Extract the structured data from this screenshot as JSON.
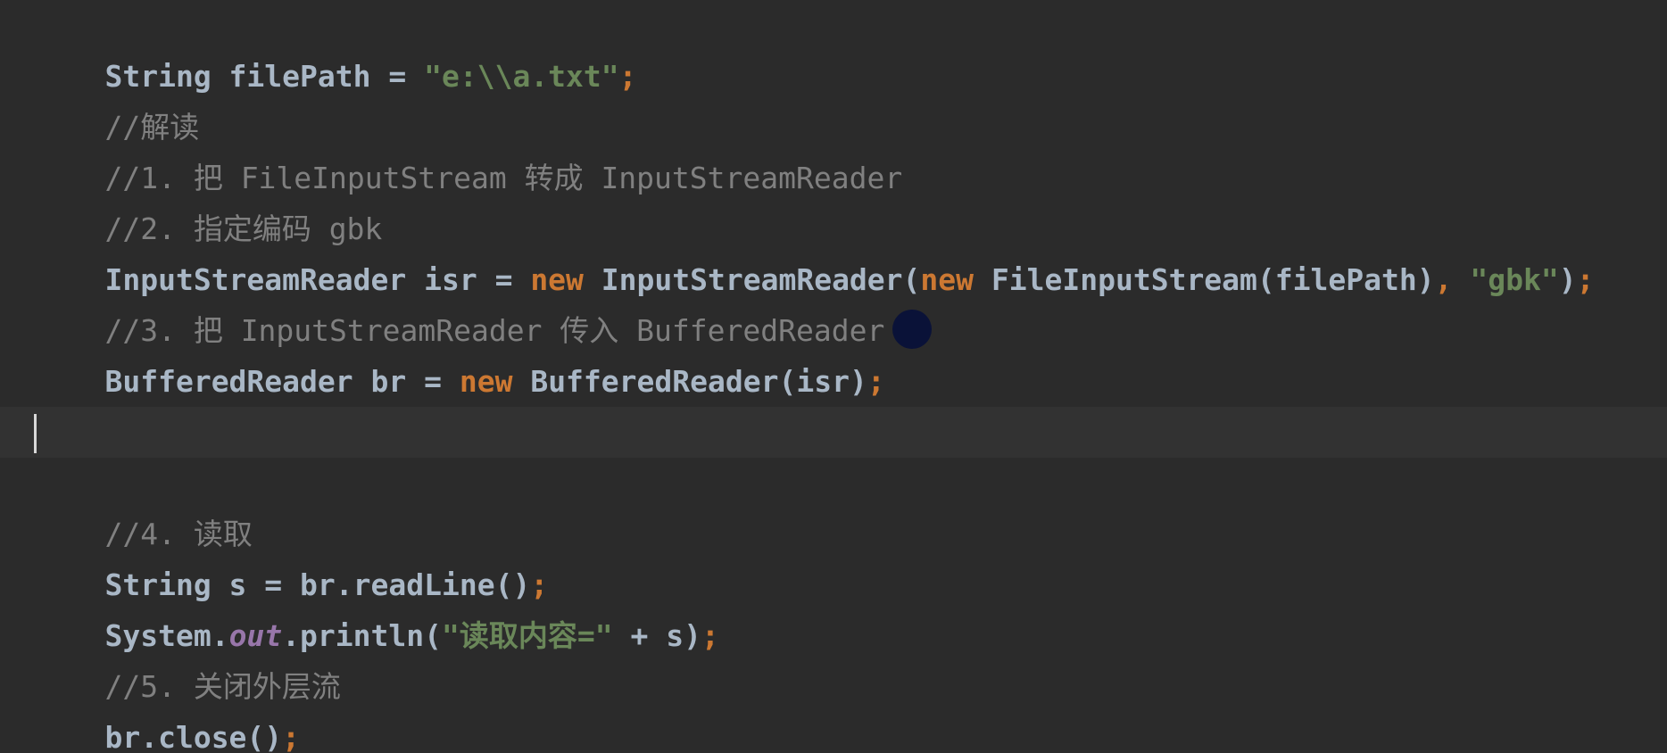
{
  "colors": {
    "background": "#2b2b2b",
    "current_line": "#323232",
    "default_text": "#a9b7c6",
    "keyword": "#cc7832",
    "string": "#6a8759",
    "comment": "#808080",
    "static_field": "#9876aa",
    "pointer": "#0a1238"
  },
  "code": {
    "line1": [
      "String filePath = ",
      "\"e:\\\\a.txt\"",
      ";"
    ],
    "line2": "//解读",
    "line3": "//1. 把 FileInputStream 转成 InputStreamReader",
    "line4": "//2. 指定编码 gbk",
    "line5": [
      "InputStreamReader isr = ",
      "new",
      " InputStreamReader(",
      "new",
      " FileInputStream(filePath)",
      ",",
      " ",
      "\"gbk\"",
      ")",
      ";"
    ],
    "line6": "//3. 把 InputStreamReader 传入 BufferedReader",
    "line7": [
      "BufferedReader br = ",
      "new",
      " BufferedReader(isr)",
      ";"
    ],
    "line8": "",
    "line9": "",
    "line10": "//4. 读取",
    "line11": [
      "String s = br.readLine()",
      ";"
    ],
    "line12": [
      "System.",
      "out",
      ".println(",
      "\"读取内容=\"",
      " + s)",
      ";"
    ],
    "line13": "//5. 关闭外层流",
    "line14": [
      "br.close()",
      ";"
    ]
  }
}
